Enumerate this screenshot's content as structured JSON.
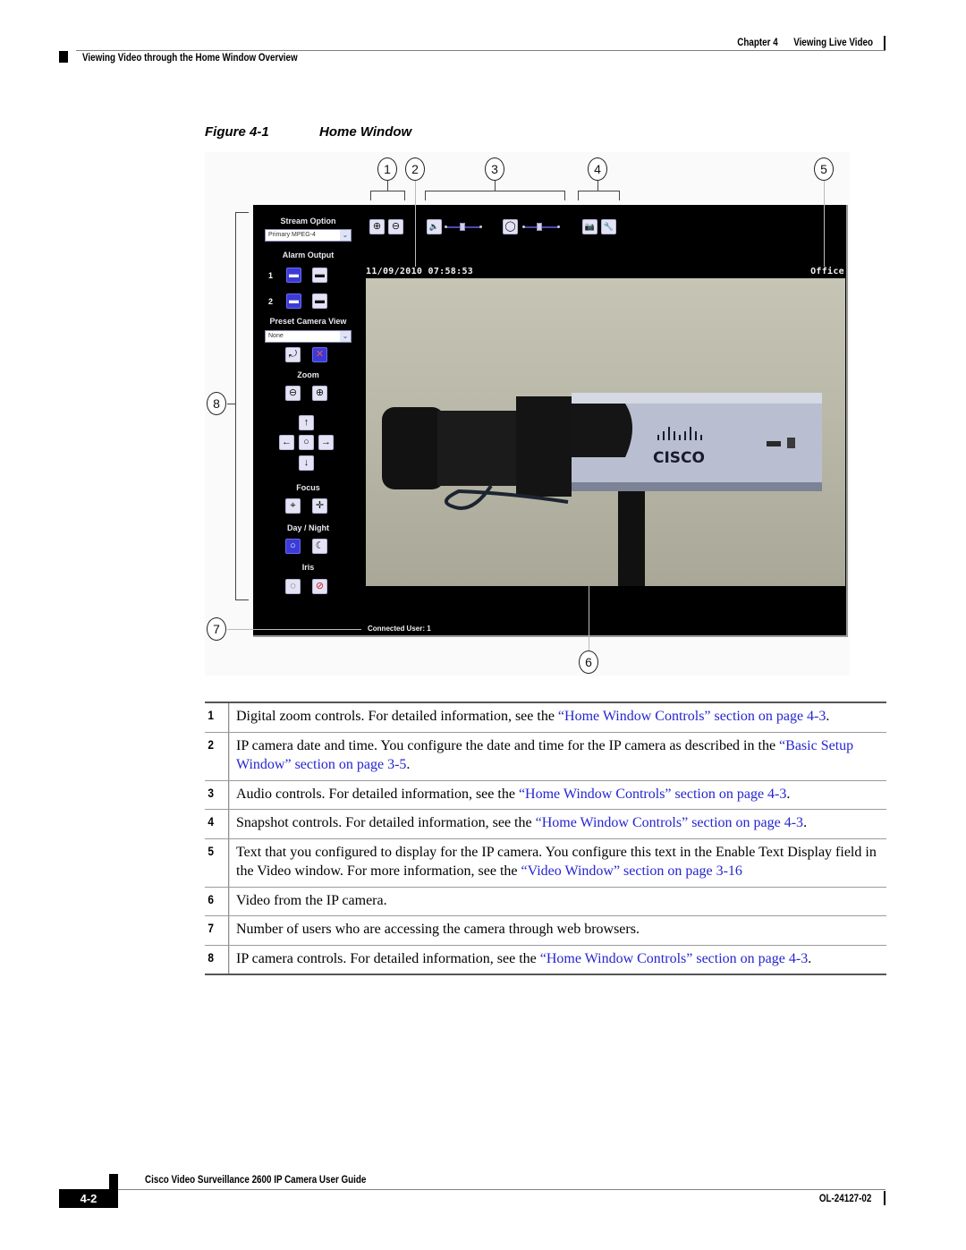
{
  "header": {
    "chapter": "Chapter 4",
    "chapter_title": "Viewing Live Video",
    "section": "Viewing Video through the Home Window Overview"
  },
  "figure": {
    "number": "Figure 4-1",
    "title": "Home Window",
    "callouts": [
      "1",
      "2",
      "3",
      "4",
      "5",
      "6",
      "7",
      "8"
    ],
    "screen": {
      "stream_option_label": "Stream Option",
      "stream_option_value": "Primary MPEG-4",
      "alarm_output_label": "Alarm Output",
      "alarm_rows": [
        "1",
        "2"
      ],
      "preset_label": "Preset Camera View",
      "preset_value": "None",
      "zoom_label": "Zoom",
      "focus_label": "Focus",
      "day_night_label": "Day / Night",
      "iris_label": "Iris",
      "datetime": "11/09/2010 07:58:53",
      "display_text": "Office",
      "connected_users": "Connected User: 1",
      "video_logo": "CISCO",
      "icons": {
        "zoom_in": "⊕",
        "zoom_out": "⊖",
        "speaker": "🔈",
        "microphone": "◯",
        "camera": "📷",
        "wrench": "🔧",
        "arrow_up": "↑",
        "arrow_down": "↓",
        "arrow_left": "←",
        "arrow_right": "→",
        "home": "○",
        "focus_near": "⌖",
        "focus_far": "✛",
        "day": "○",
        "night": "☾",
        "iris_open": "◌",
        "iris_close": "⊘",
        "preset_go": "⤾",
        "preset_clear": "✕",
        "alarm_on": "▬",
        "alarm_off": "▬",
        "dropdown": "⌄"
      }
    }
  },
  "legend": [
    {
      "num": "1",
      "text": "Digital zoom controls. For detailed information, see the ",
      "link": "“Home Window Controls” section on page 4-3",
      "tail": "."
    },
    {
      "num": "2",
      "text": "IP camera date and time. You configure the date and time for the IP camera as described in the ",
      "link": "“Basic Setup Window” section on page 3-5",
      "tail": "."
    },
    {
      "num": "3",
      "text": "Audio controls. For detailed information, see the ",
      "link": "“Home Window Controls” section on page 4-3",
      "tail": "."
    },
    {
      "num": "4",
      "text": "Snapshot controls. For detailed information, see the ",
      "link": "“Home Window Controls” section on page 4-3",
      "tail": "."
    },
    {
      "num": "5",
      "text": "Text that you configured to display for the IP camera. You configure this text in the Enable Text Display field in the Video window. For more information, see the ",
      "link": "“Video Window” section on page 3-16",
      "tail": ""
    },
    {
      "num": "6",
      "text": "Video from the IP camera.",
      "link": "",
      "tail": ""
    },
    {
      "num": "7",
      "text": "Number of users who are accessing the camera through web browsers.",
      "link": "",
      "tail": ""
    },
    {
      "num": "8",
      "text": "IP camera controls. For detailed information, see the ",
      "link": "“Home Window Controls” section on page 4-3",
      "tail": "."
    }
  ],
  "footer": {
    "guide_title": "Cisco Video Surveillance 2600 IP Camera User Guide",
    "page": "4-2",
    "doc_number": "OL-24127-02"
  },
  "colors": {
    "link": "#2525d0",
    "active_button": "#3b3bd8"
  }
}
